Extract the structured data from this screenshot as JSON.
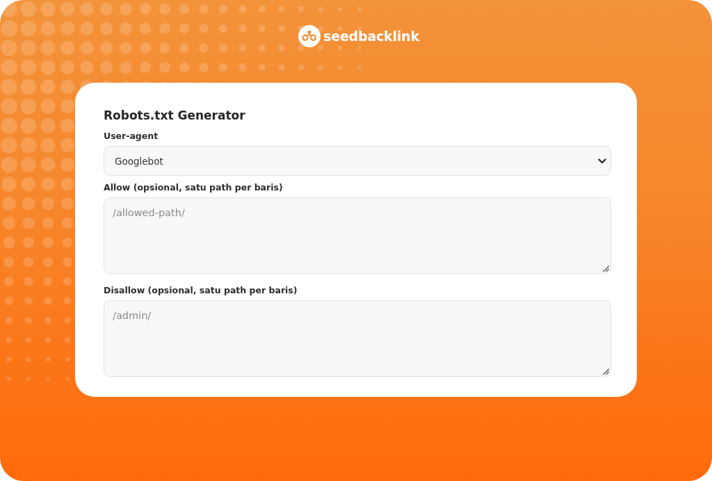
{
  "logo": {
    "text": "seedbacklink"
  },
  "card": {
    "title": "Robots.txt Generator",
    "fields": [
      {
        "kind": "select",
        "label": "User-agent",
        "value": "Googlebot"
      },
      {
        "kind": "textarea",
        "label": "Allow (opsional, satu path per baris)",
        "placeholder": "/allowed-path/"
      },
      {
        "kind": "textarea",
        "label": "Disallow (opsional, satu path per baris)",
        "placeholder": "/admin/"
      }
    ]
  }
}
